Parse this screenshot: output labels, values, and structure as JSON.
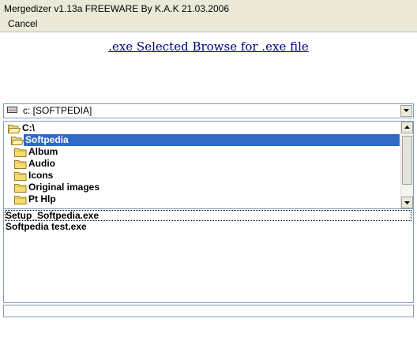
{
  "window": {
    "title": "Mergedizer v1.13a FREEWARE By K.A.K 21.03.2006"
  },
  "menu": {
    "items": [
      "Cancel"
    ]
  },
  "heading": {
    "text": ".exe Selected Browse for .exe file"
  },
  "drive": {
    "label": "c: [SOFTPEDIA]"
  },
  "directories": [
    {
      "name": "C:\\",
      "state": "open",
      "selected": false
    },
    {
      "name": "Softpedia",
      "state": "open",
      "selected": true
    },
    {
      "name": "Album",
      "state": "closed",
      "selected": false
    },
    {
      "name": "Audio",
      "state": "closed",
      "selected": false
    },
    {
      "name": "Icons",
      "state": "closed",
      "selected": false
    },
    {
      "name": "Original images",
      "state": "closed",
      "selected": false
    },
    {
      "name": "Pt Hlp",
      "state": "closed",
      "selected": false
    }
  ],
  "files": [
    {
      "name": "Setup_Softpedia.exe",
      "focused": true
    },
    {
      "name": "Softpedia test.exe",
      "focused": false
    }
  ],
  "status": {
    "text": ""
  },
  "icons": {
    "drive": "drive-icon",
    "folder_open": "folder-open-icon",
    "folder_closed": "folder-closed-icon",
    "dropdown": "chevron-down-icon"
  },
  "colors": {
    "selection": "#316ac5",
    "heading": "#000080"
  }
}
